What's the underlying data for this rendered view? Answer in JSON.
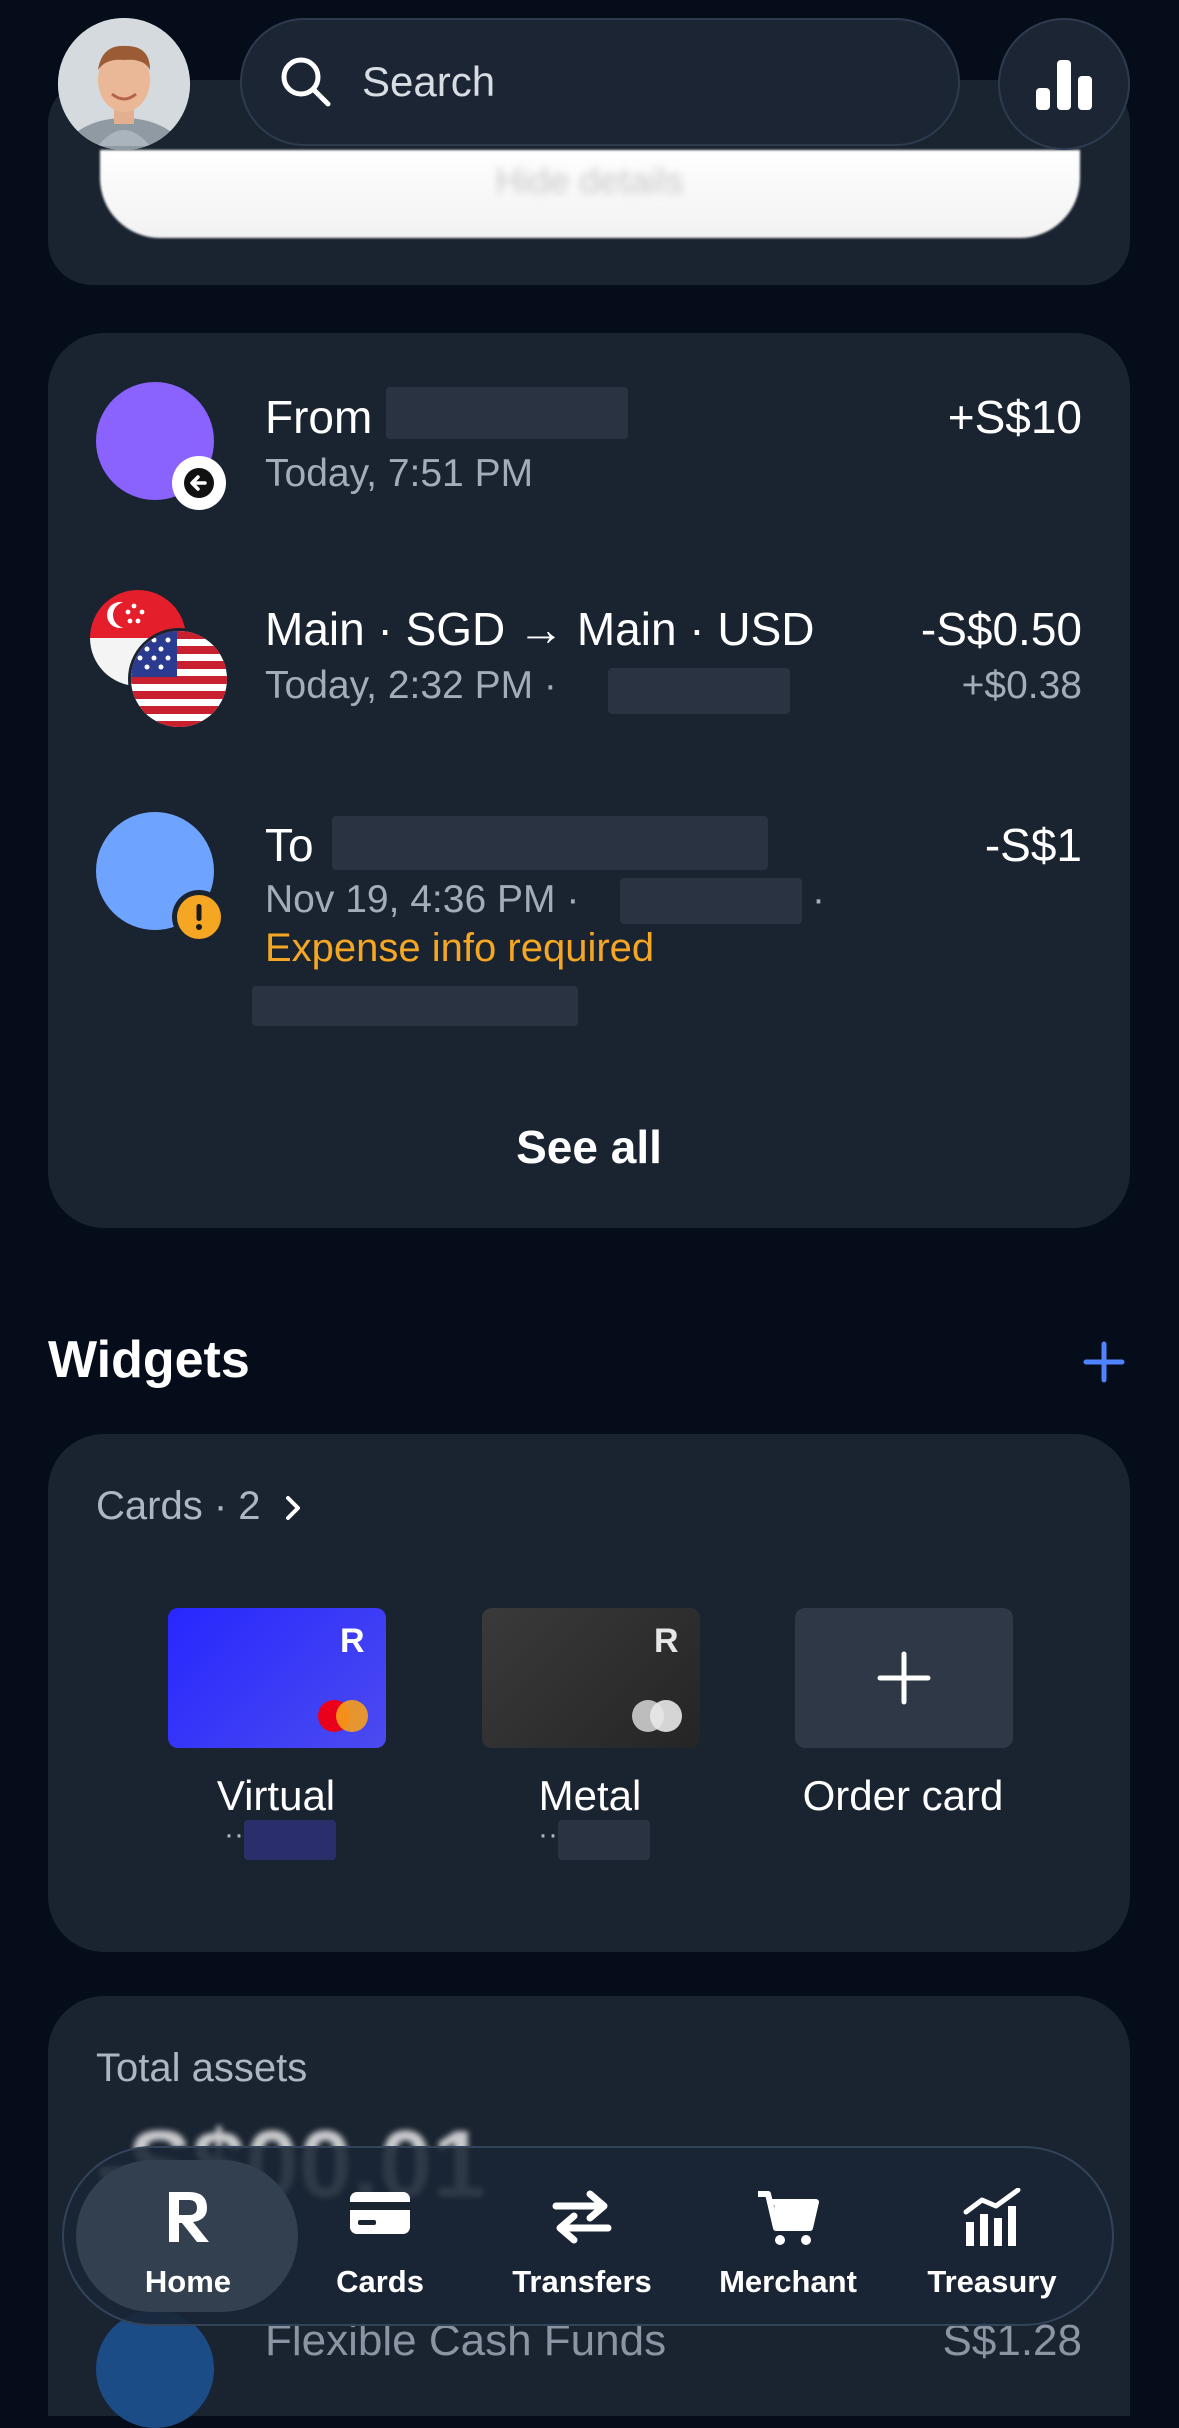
{
  "header": {
    "search_placeholder": "Search"
  },
  "top_card": {
    "strip_text": "Hide details"
  },
  "transactions": [
    {
      "title": "From",
      "subtitle": "Today, 7:51 PM",
      "amount": "+S$10",
      "avatar_color": "#8a63ff",
      "badge": "arrow-left-icon"
    },
    {
      "title": "Main · SGD → Main · USD",
      "subtitle": "Today, 2:32 PM ·",
      "amount": "-S$0.50",
      "secondary_amount": "+$0.38"
    },
    {
      "title": "To",
      "subtitle": "Nov 19, 4:36 PM ·",
      "sub_suffix": "·",
      "warning": "Expense info required",
      "amount": "-S$1",
      "avatar_color": "#6ea4ff"
    }
  ],
  "see_all_label": "See all",
  "widgets": {
    "title": "Widgets",
    "cards_header": "Cards · 2",
    "cards": [
      {
        "label": "Virtual",
        "masked": "··",
        "color": "#3a3af5"
      },
      {
        "label": "Metal",
        "masked": "··",
        "color": "#2e2e2e"
      },
      {
        "label": "Order card"
      }
    ]
  },
  "assets": {
    "label": "Total assets",
    "value": "-S$00.01",
    "row_label": "Flexible Cash Funds",
    "row_amount": "S$1.28"
  },
  "nav": [
    {
      "label": "Home",
      "icon": "revolut-r-icon",
      "active": true
    },
    {
      "label": "Cards",
      "icon": "card-icon"
    },
    {
      "label": "Transfers",
      "icon": "transfer-arrows-icon"
    },
    {
      "label": "Merchant",
      "icon": "cart-icon"
    },
    {
      "label": "Treasury",
      "icon": "bar-chart-trend-icon"
    }
  ],
  "colors": {
    "background": "#050d1a",
    "card": "#1a2330",
    "accent": "#4f83ff",
    "warning": "#f5a623"
  }
}
